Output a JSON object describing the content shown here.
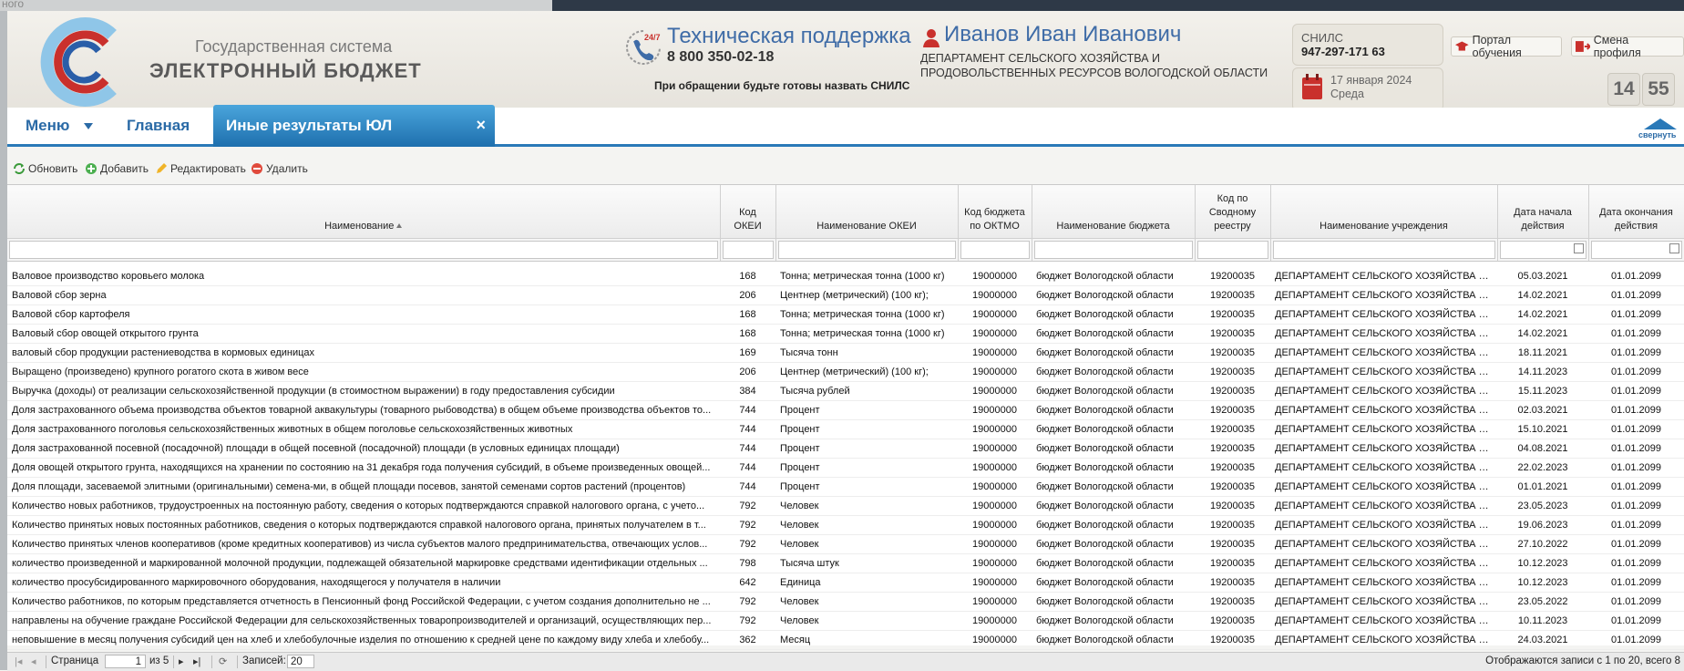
{
  "strip_text": "ного",
  "header": {
    "logo_line1": "Государственная система",
    "logo_line2": "ЭЛЕКТРОННЫЙ БЮДЖЕТ",
    "support_badge": "24/7",
    "support_title": "Техническая поддержка",
    "support_phone": "8 800 350-02-18",
    "support_note": "При обращении будьте готовы назвать СНИЛС",
    "user_name": "Иванов Иван Иванович",
    "user_dept_line1": "ДЕПАРТАМЕНТ СЕЛЬСКОГО ХОЗЯЙСТВА И",
    "user_dept_line2": "ПРОДОВОЛЬСТВЕННЫХ РЕСУРСОВ ВОЛОГОДСКОЙ ОБЛАСТИ",
    "snils_label": "СНИЛС",
    "snils_value": "947-297-171 63",
    "date": "17 января 2024",
    "weekday": "Среда",
    "portal_button": "Портал обучения",
    "profile_button": "Смена профиля",
    "clock_hours": "14",
    "clock_minutes": "55"
  },
  "tabs": {
    "menu": "Меню",
    "home": "Главная",
    "active": "Иные результаты ЮЛ",
    "close": "×",
    "collapse": "свернуть"
  },
  "toolbar": {
    "refresh": "Обновить",
    "add": "Добавить",
    "edit": "Редактировать",
    "delete": "Удалить"
  },
  "columns": {
    "name": "Наименование",
    "okei_code_1": "Код",
    "okei_code_2": "ОКЕИ",
    "okei_name": "Наименование ОКЕИ",
    "budget_code_1": "Код бюджета",
    "budget_code_2": "по ОКТМО",
    "budget_name": "Наименование бюджета",
    "registry_1": "Код по",
    "registry_2": "Сводному",
    "registry_3": "реестру",
    "institution": "Наименование учреждения",
    "start_1": "Дата начала",
    "start_2": "действия",
    "end_1": "Дата окончания",
    "end_2": "действия"
  },
  "rows": [
    {
      "name": "Валовое производство коровьего молока",
      "okei": "168",
      "okei_name": "Тонна; метрическая тонна (1000 кг)",
      "oktmo": "19000000",
      "budget": "бюджет Вологодской области",
      "reg": "19200035",
      "inst": "ДЕПАРТАМЕНТ СЕЛЬСКОГО ХОЗЯЙСТВА И П...",
      "start": "05.03.2021",
      "end": "01.01.2099"
    },
    {
      "name": "Валовой сбор зерна",
      "okei": "206",
      "okei_name": "Центнер (метрический) (100 кг);",
      "oktmo": "19000000",
      "budget": "бюджет Вологодской области",
      "reg": "19200035",
      "inst": "ДЕПАРТАМЕНТ СЕЛЬСКОГО ХОЗЯЙСТВА И П...",
      "start": "14.02.2021",
      "end": "01.01.2099"
    },
    {
      "name": "Валовой сбор картофеля",
      "okei": "168",
      "okei_name": "Тонна; метрическая тонна (1000 кг)",
      "oktmo": "19000000",
      "budget": "бюджет Вологодской области",
      "reg": "19200035",
      "inst": "ДЕПАРТАМЕНТ СЕЛЬСКОГО ХОЗЯЙСТВА И П...",
      "start": "14.02.2021",
      "end": "01.01.2099"
    },
    {
      "name": "Валовый сбор овощей открытого грунта",
      "okei": "168",
      "okei_name": "Тонна; метрическая тонна (1000 кг)",
      "oktmo": "19000000",
      "budget": "бюджет Вологодской области",
      "reg": "19200035",
      "inst": "ДЕПАРТАМЕНТ СЕЛЬСКОГО ХОЗЯЙСТВА И П...",
      "start": "14.02.2021",
      "end": "01.01.2099"
    },
    {
      "name": "валовый сбор продукции растениеводства в кормовых единицах",
      "okei": "169",
      "okei_name": "Тысяча тонн",
      "oktmo": "19000000",
      "budget": "бюджет Вологодской области",
      "reg": "19200035",
      "inst": "ДЕПАРТАМЕНТ СЕЛЬСКОГО ХОЗЯЙСТВА И П...",
      "start": "18.11.2021",
      "end": "01.01.2099"
    },
    {
      "name": "Выращено (произведено) крупного рогатого скота в живом весе",
      "okei": "206",
      "okei_name": "Центнер (метрический) (100 кг);",
      "oktmo": "19000000",
      "budget": "бюджет Вологодской области",
      "reg": "19200035",
      "inst": "ДЕПАРТАМЕНТ СЕЛЬСКОГО ХОЗЯЙСТВА И П...",
      "start": "14.11.2023",
      "end": "01.01.2099"
    },
    {
      "name": "Выручка (доходы) от реализации сельскохозяйственной продукции (в стоимостном выражении) в году предоставления субсидии",
      "okei": "384",
      "okei_name": "Тысяча рублей",
      "oktmo": "19000000",
      "budget": "бюджет Вологодской области",
      "reg": "19200035",
      "inst": "ДЕПАРТАМЕНТ СЕЛЬСКОГО ХОЗЯЙСТВА И П...",
      "start": "15.11.2023",
      "end": "01.01.2099"
    },
    {
      "name": "Доля застрахованного объема производства объектов товарной аквакультуры (товарного рыбоводства) в общем объеме производства объектов то...",
      "okei": "744",
      "okei_name": "Процент",
      "oktmo": "19000000",
      "budget": "бюджет Вологодской области",
      "reg": "19200035",
      "inst": "ДЕПАРТАМЕНТ СЕЛЬСКОГО ХОЗЯЙСТВА И П...",
      "start": "02.03.2021",
      "end": "01.01.2099"
    },
    {
      "name": "Доля застрахованного поголовья сельскохозяйственных животных в общем поголовье сельскохозяйственных животных",
      "okei": "744",
      "okei_name": "Процент",
      "oktmo": "19000000",
      "budget": "бюджет Вологодской области",
      "reg": "19200035",
      "inst": "ДЕПАРТАМЕНТ СЕЛЬСКОГО ХОЗЯЙСТВА И П...",
      "start": "15.10.2021",
      "end": "01.01.2099"
    },
    {
      "name": "Доля застрахованной посевной (посадочной) площади в общей посевной (посадочной) площади (в условных единицах площади)",
      "okei": "744",
      "okei_name": "Процент",
      "oktmo": "19000000",
      "budget": "бюджет Вологодской области",
      "reg": "19200035",
      "inst": "ДЕПАРТАМЕНТ СЕЛЬСКОГО ХОЗЯЙСТВА И П...",
      "start": "04.08.2021",
      "end": "01.01.2099"
    },
    {
      "name": "Доля овощей открытого грунта, находящихся на хранении по состоянию на 31 декабря года получения субсидий, в объеме произведенных овощей...",
      "okei": "744",
      "okei_name": "Процент",
      "oktmo": "19000000",
      "budget": "бюджет Вологодской области",
      "reg": "19200035",
      "inst": "ДЕПАРТАМЕНТ СЕЛЬСКОГО ХОЗЯЙСТВА И П...",
      "start": "22.02.2023",
      "end": "01.01.2099"
    },
    {
      "name": "Доля площади, засеваемой элитными (оригинальными) семена-ми, в общей площади посевов, занятой семенами сортов растений (процентов)",
      "okei": "744",
      "okei_name": "Процент",
      "oktmo": "19000000",
      "budget": "бюджет Вологодской области",
      "reg": "19200035",
      "inst": "ДЕПАРТАМЕНТ СЕЛЬСКОГО ХОЗЯЙСТВА И П...",
      "start": "01.01.2021",
      "end": "01.01.2099"
    },
    {
      "name": "Количество новых работников, трудоустроенных на постоянную работу, сведения о которых подтверждаются справкой налогового органа, с учето...",
      "okei": "792",
      "okei_name": "Человек",
      "oktmo": "19000000",
      "budget": "бюджет Вологодской области",
      "reg": "19200035",
      "inst": "ДЕПАРТАМЕНТ СЕЛЬСКОГО ХОЗЯЙСТВА И П...",
      "start": "23.05.2023",
      "end": "01.01.2099"
    },
    {
      "name": "Количество принятых новых постоянных работников, сведения о которых подтверждаются справкой налогового органа, принятых получателем в т...",
      "okei": "792",
      "okei_name": "Человек",
      "oktmo": "19000000",
      "budget": "бюджет Вологодской области",
      "reg": "19200035",
      "inst": "ДЕПАРТАМЕНТ СЕЛЬСКОГО ХОЗЯЙСТВА И П...",
      "start": "19.06.2023",
      "end": "01.01.2099"
    },
    {
      "name": "Количество принятых членов кооперативов (кроме кредитных кооперативов) из числа субъектов малого предпринимательства, отвечающих услов...",
      "okei": "792",
      "okei_name": "Человек",
      "oktmo": "19000000",
      "budget": "бюджет Вологодской области",
      "reg": "19200035",
      "inst": "ДЕПАРТАМЕНТ СЕЛЬСКОГО ХОЗЯЙСТВА И П...",
      "start": "27.10.2022",
      "end": "01.01.2099"
    },
    {
      "name": "количество произведенной и маркированной молочной продукции, подлежащей обязательной маркировке средствами идентификации отдельных ...",
      "okei": "798",
      "okei_name": "Тысяча штук",
      "oktmo": "19000000",
      "budget": "бюджет Вологодской области",
      "reg": "19200035",
      "inst": "ДЕПАРТАМЕНТ СЕЛЬСКОГО ХОЗЯЙСТВА И П...",
      "start": "10.12.2023",
      "end": "01.01.2099"
    },
    {
      "name": "количество просубсидированного маркировочного оборудования, находящегося у получателя в наличии",
      "okei": "642",
      "okei_name": "Единица",
      "oktmo": "19000000",
      "budget": "бюджет Вологодской области",
      "reg": "19200035",
      "inst": "ДЕПАРТАМЕНТ СЕЛЬСКОГО ХОЗЯЙСТВА И П...",
      "start": "10.12.2023",
      "end": "01.01.2099"
    },
    {
      "name": "Количество работников, по которым представляется отчетность в Пенсионный фонд Российской Федерации, с учетом создания дополнительно не ...",
      "okei": "792",
      "okei_name": "Человек",
      "oktmo": "19000000",
      "budget": "бюджет Вологодской области",
      "reg": "19200035",
      "inst": "ДЕПАРТАМЕНТ СЕЛЬСКОГО ХОЗЯЙСТВА И П...",
      "start": "23.05.2022",
      "end": "01.01.2099"
    },
    {
      "name": "направлены на обучение граждане Российской Федерации для сельскохозяйственных товаропроизводителей и организаций, осуществляющих пер...",
      "okei": "792",
      "okei_name": "Человек",
      "oktmo": "19000000",
      "budget": "бюджет Вологодской области",
      "reg": "19200035",
      "inst": "ДЕПАРТАМЕНТ СЕЛЬСКОГО ХОЗЯЙСТВА И П...",
      "start": "10.11.2023",
      "end": "01.01.2099"
    },
    {
      "name": "неповышение в месяц получения субсидий цен на хлеб и хлебобулочные изделия по отношению к средней цене по каждому виду хлеба и хлебобу...",
      "okei": "362",
      "okei_name": "Месяц",
      "oktmo": "19000000",
      "budget": "бюджет Вологодской области",
      "reg": "19200035",
      "inst": "ДЕПАРТАМЕНТ СЕЛЬСКОГО ХОЗЯЙСТВА И П...",
      "start": "24.03.2021",
      "end": "01.01.2099"
    }
  ],
  "pager": {
    "page_label": "Страница",
    "page_value": "1",
    "of_pages": "из 5",
    "records_label": "Записей:",
    "records_value": "20",
    "summary": "Отображаются записи с 1 по 20, всего 8"
  }
}
